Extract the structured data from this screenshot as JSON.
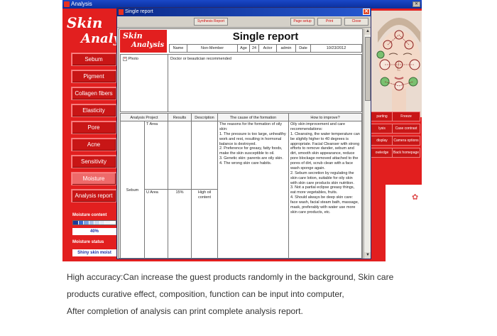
{
  "app": {
    "title": "Analysis",
    "logo_line1": "Skin",
    "logo_line2": "Analysis",
    "menu": [
      {
        "label": "Sebum"
      },
      {
        "label": "Pigment"
      },
      {
        "label": "Collagen fibers"
      },
      {
        "label": "Elasticity"
      },
      {
        "label": "Pore"
      },
      {
        "label": "Acne"
      },
      {
        "label": "Sensitivity"
      },
      {
        "label": "Moisture"
      },
      {
        "label": "Analysis report"
      }
    ],
    "moisture_content_label": "Moisture content",
    "moisture_percent": "40%",
    "moisture_status_label": "Moisture  status",
    "moisture_status": "Shiny skin moist",
    "right_buttons": [
      {
        "label": "parting"
      },
      {
        "label": "Freeze"
      },
      {
        "label": "lysis"
      },
      {
        "label": "Case contrast"
      },
      {
        "label": "display"
      },
      {
        "label": "Camera options"
      },
      {
        "label": "owledge"
      },
      {
        "label": "Back homepage"
      }
    ],
    "colors": {
      "brand_red": "#e21f1f",
      "title_blue": "#0b2a8a"
    }
  },
  "report": {
    "window_title": "Single report",
    "toolbar": {
      "synthesis": "Synthesis Report",
      "page_setup": "Page setup",
      "print": "Print",
      "close": "Close"
    },
    "logo_line1": "Skin",
    "logo_line2": "Analysis",
    "heading": "Single report",
    "info": {
      "name_label": "Name",
      "name_value": "Non-Member",
      "age_label": "Age",
      "age_value": "24",
      "actor_label": "Actor",
      "actor_value": "admin",
      "date_label": "Date",
      "date_value": "10/23/2012"
    },
    "photo_label": "Photo",
    "doctor_label": "Doctor or beautician recommended",
    "table": {
      "headers": [
        "Analysis Project",
        "Results",
        "Description",
        "The cause of the formation",
        "How to improve?"
      ],
      "project": "Sebum",
      "rows": [
        {
          "area": "T Area",
          "result": "",
          "description": ""
        },
        {
          "area": "U Area",
          "result": "15%",
          "description": "High oil content"
        }
      ],
      "cause": "The reasons for the formation of oily skin:\n1. The pressure is too large, unhealthy work and rest, resulting in hormonal balance is destroyed.\n2. Preference for greasy, fatty foods, make the skin susceptible to oil.\n3. Genetic skin: parents are oily skin.\n4. The wrong skin care habits.",
      "improve": "Oily skin improvement and care recommendations:\n1. Cleansing, the water temperature can be slightly higher to 40 degrees is appropriate. Facial Cleanser with strong efforts to remove dander, sebum and dirt, smooth skin appearance, reduce pore blockage removed attached to the pores of dirt, scrub clean with a face wash sponge again.\n2. Sebum secretion by regulating the skin care lotion, suitable for oily skin with skin care products skin nutrition.\n3. Not a partial eclipse greasy things, eat more vegetables, fruits.\n4. Should always be deep skin care: face wash, facial steam bath, massage, mask, preferably with water use more skin care products, etc."
    }
  },
  "caption": {
    "line1": "High accuracy:Can increase the guest products randomly in the background, Skin care",
    "line2": "products curative effect, composition, function can be input into computer,",
    "line3": "After completion of analysis can print complete analysis report."
  }
}
